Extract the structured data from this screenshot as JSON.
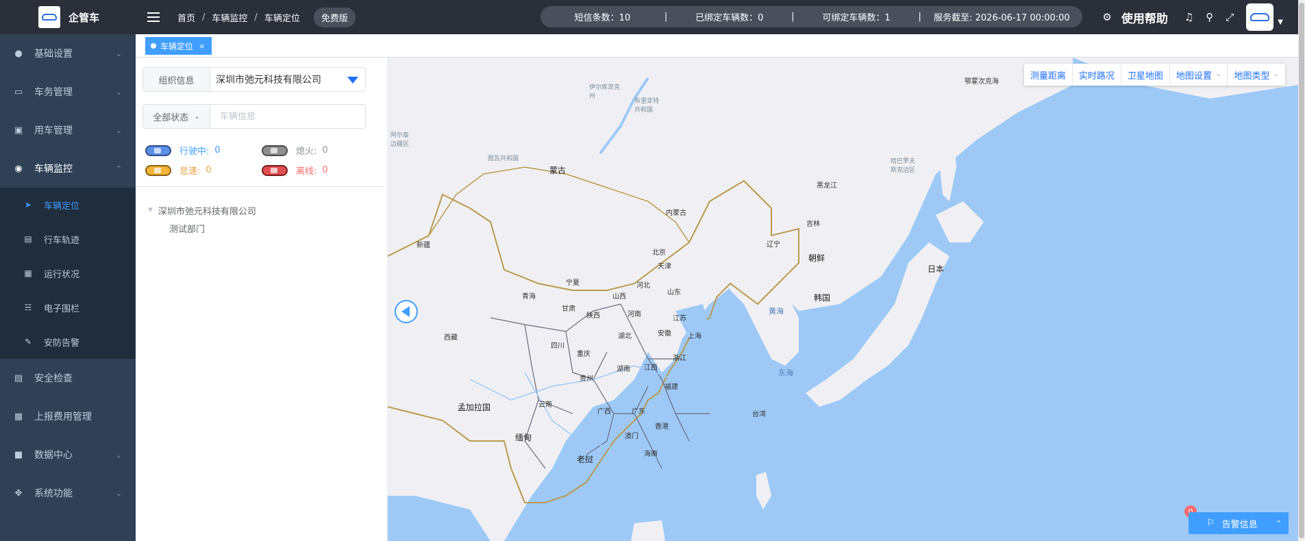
{
  "brand": {
    "name": "企管车"
  },
  "sidebar": {
    "items": [
      {
        "label": "基础设置",
        "icon": "user-cog-icon",
        "has_children": true
      },
      {
        "label": "车务管理",
        "icon": "monitor-icon",
        "has_children": true
      },
      {
        "label": "用车管理",
        "icon": "car-list-icon",
        "has_children": true
      },
      {
        "label": "车辆监控",
        "icon": "globe-icon",
        "has_children": true,
        "expanded": true
      }
    ],
    "sub_items": [
      {
        "label": "车辆定位",
        "icon": "send-icon",
        "active": true
      },
      {
        "label": "行车轨迹",
        "icon": "trajectory-icon"
      },
      {
        "label": "运行状况",
        "icon": "grid-icon"
      },
      {
        "label": "电子围栏",
        "icon": "fence-icon"
      },
      {
        "label": "安防告警",
        "icon": "edit-icon"
      }
    ],
    "items_after": [
      {
        "label": "安全检查",
        "icon": "tablet-icon",
        "has_children": false
      },
      {
        "label": "上报费用管理",
        "icon": "table-icon",
        "has_children": false
      },
      {
        "label": "数据中心",
        "icon": "lock-icon",
        "has_children": true
      },
      {
        "label": "系统功能",
        "icon": "move-icon",
        "has_children": true
      }
    ]
  },
  "topbar": {
    "breadcrumb": [
      "首页",
      "车辆监控",
      "车辆定位"
    ],
    "separator": "/",
    "edition_badge": "免费版",
    "stats": {
      "sms_count": "短信条数：10",
      "bound": "已绑定车辆数：0",
      "bindable": "可绑定车辆数：1",
      "service_until": "服务截至: 2026-06-17 00:00:00",
      "divider": "|"
    },
    "help_label": "使用帮助"
  },
  "tagsview": {
    "active_tag": "车辆定位",
    "close": "×"
  },
  "panel": {
    "org_label": "组织信息",
    "org_value": "深圳市弛元科技有限公司",
    "status_select": "全部状态",
    "vehicle_placeholder": "车辆信息",
    "legend": [
      {
        "label": "行驶中:",
        "count": "0",
        "color": "#409eff"
      },
      {
        "label": "熄火:",
        "count": "0",
        "color": "#909399"
      },
      {
        "label": "怠速:",
        "count": "0",
        "color": "#e6a23c"
      },
      {
        "label": "离线:",
        "count": "0",
        "color": "#f56c6c"
      }
    ],
    "tree": {
      "root": "深圳市弛元科技有限公司",
      "children": [
        "测试部门"
      ]
    }
  },
  "map": {
    "toolbar": {
      "measure": "测量距离",
      "traffic": "实时路况",
      "satellite": "卫星地图",
      "settings": "地图设置",
      "type": "地图类型"
    },
    "labels": {
      "mongolia": "蒙古",
      "xinjiang": "新疆",
      "neimenggu": "内蒙古",
      "heilongjiang": "黑龙江",
      "jilin": "吉林",
      "liaoning": "辽宁",
      "beijing": "北京",
      "tianjin": "天津",
      "hebei": "河北",
      "shanxi": "山西",
      "shandong": "山东",
      "ningxia": "宁夏",
      "qinghai": "青海",
      "gansu": "甘肃",
      "shaanxi": "陕西",
      "henan": "河南",
      "jiangsu": "江苏",
      "shanghai": "上海",
      "anhui": "安徽",
      "hubei": "湖北",
      "sichuan": "四川",
      "chongqing": "重庆",
      "zhejiang": "浙江",
      "xizang": "西藏",
      "guizhou": "贵州",
      "hunan": "湖南",
      "jiangxi": "江西",
      "fujian": "福建",
      "yunnan": "云南",
      "guangxi": "广西",
      "guangdong": "广东",
      "hongkong": "香港",
      "macau": "澳门",
      "taiwan": "台湾",
      "hainan": "海南",
      "north_korea": "朝鲜",
      "south_korea": "韩国",
      "japan": "日本",
      "yellow_sea": "黄海",
      "east_sea": "东海",
      "bangladesh": "孟加拉国",
      "myanmar": "缅甸",
      "laos": "老挝",
      "okhotsk": "鄂霍次克海",
      "khabarovsk": "哈巴罗夫\n斯克边区",
      "irkutsk": "伊尔库茨克\n州",
      "buryatia": "布里亚特\n共和国",
      "tuva": "图瓦共和国",
      "altai": "阿尔泰\n边疆区"
    },
    "alarm_label": "告警信息",
    "alarm_count": "0"
  }
}
